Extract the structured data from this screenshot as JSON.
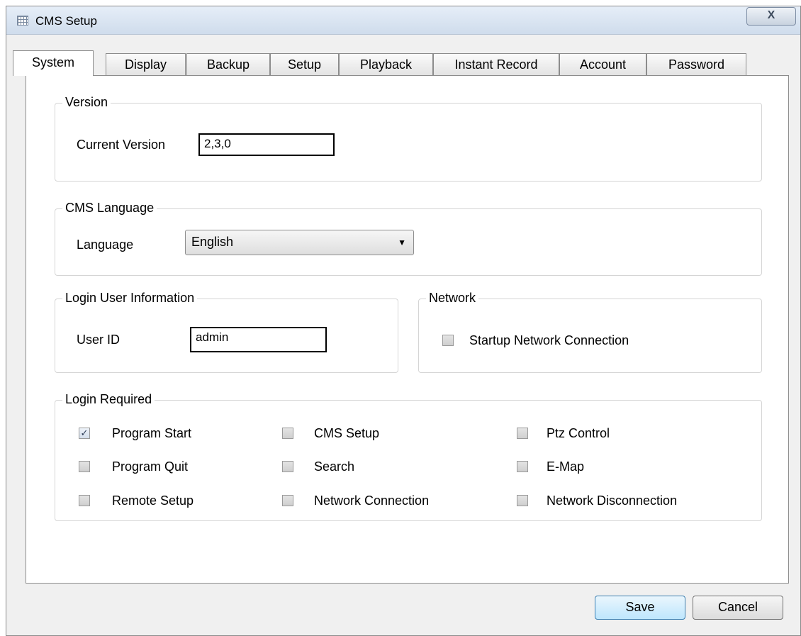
{
  "window": {
    "title": "CMS Setup",
    "close_glyph": "X"
  },
  "tabs": [
    {
      "label": "System",
      "active": true
    },
    {
      "label": "Display",
      "active": false
    },
    {
      "label": "Backup",
      "active": false
    },
    {
      "label": "Setup",
      "active": false
    },
    {
      "label": "Playback",
      "active": false
    },
    {
      "label": "Instant Record",
      "active": false
    },
    {
      "label": "Account",
      "active": false
    },
    {
      "label": "Password",
      "active": false
    }
  ],
  "version": {
    "group_label": "Version",
    "current_version_label": "Current Version",
    "current_version_value": "2,3,0"
  },
  "language": {
    "group_label": "CMS Language",
    "language_label": "Language",
    "selected": "English"
  },
  "login_user": {
    "group_label": "Login User Information",
    "user_id_label": "User ID",
    "user_id_value": "admin"
  },
  "network": {
    "group_label": "Network",
    "startup_connection_label": "Startup Network Connection",
    "startup_connection_checked": false
  },
  "login_required": {
    "group_label": "Login Required",
    "options": [
      {
        "label": "Program Start",
        "checked": true
      },
      {
        "label": "CMS Setup",
        "checked": false
      },
      {
        "label": "Ptz Control",
        "checked": false
      },
      {
        "label": "Program Quit",
        "checked": false
      },
      {
        "label": "Search",
        "checked": false
      },
      {
        "label": "E-Map",
        "checked": false
      },
      {
        "label": "Remote Setup",
        "checked": false
      },
      {
        "label": "Network Connection",
        "checked": false
      },
      {
        "label": "Network Disconnection",
        "checked": false
      }
    ]
  },
  "buttons": {
    "save": "Save",
    "cancel": "Cancel"
  },
  "icons": {
    "app": "grid-app-icon",
    "close": "close-icon",
    "dropdown": "chevron-down-icon",
    "check": "check-icon"
  },
  "colors": {
    "save_button": "#bee6fd",
    "titlebar": "#cfdcec"
  }
}
